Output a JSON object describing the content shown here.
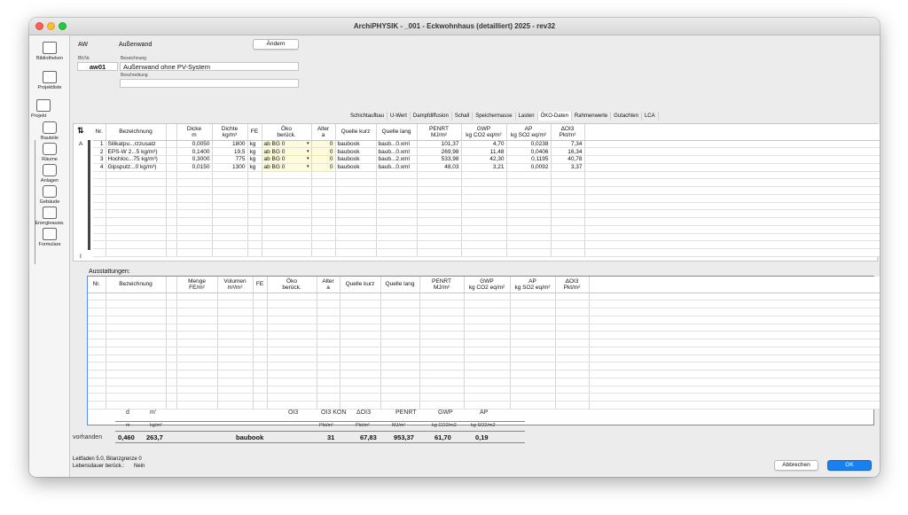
{
  "window": {
    "title": "ArchiPHYSIK - _001 - Eckwohnhaus (detailliert) 2025 - rev32"
  },
  "sidebar": {
    "items": [
      {
        "label": "Bibliotheken"
      },
      {
        "label": "Projektliste"
      },
      {
        "label": "Projekt"
      },
      {
        "label": "Bauteile"
      },
      {
        "label": "Räume"
      },
      {
        "label": "Anlagen"
      },
      {
        "label": "Gebäude"
      },
      {
        "label": "Energieausw."
      },
      {
        "label": "Formulare"
      }
    ]
  },
  "header": {
    "type_code": "AW",
    "type_name": "Außenwand",
    "change_button": "Ändern",
    "blt_nr_label": "Blt.Nr.",
    "blt_nr_value": "aw01",
    "bezeichnung_label": "Bezeichnung",
    "bezeichnung_value": "Außenwand ohne PV-System",
    "beschreibung_label": "Beschreibung",
    "beschreibung_value": ""
  },
  "tabs": [
    "Schichtaufbau",
    "U-Wert",
    "Dampfdiffusion",
    "Schall",
    "Speichermasse",
    "Lasten",
    "ÖKO-Daten",
    "Rahmenwerte",
    "Gutachten",
    "LCA"
  ],
  "active_tab": "ÖKO-Daten",
  "layers": {
    "side_marker_top": "A",
    "side_marker_bottom": "I",
    "sort_icon": "⇅",
    "columns": [
      "Nr.",
      "Bezeichnung",
      "",
      "Dicke\nm",
      "Dichte\nkg/m³",
      "FE",
      "Öko\nberück.",
      "Alter\na",
      "Quelle kurz",
      "Quelle lang",
      "PENRT\nMJ/m²",
      "GWP\nkg CO2 eq/m²",
      "AP\nkg SO2 eq/m²",
      "ΔOI3\nPkt/m²",
      ""
    ],
    "rows": [
      [
        "1",
        "Silikatpu...rzzusatz",
        "",
        "0,0050",
        "1800",
        "kg",
        "ab BG 0",
        "0",
        "baubook",
        "baub...0.xml",
        "101,37",
        "4,70",
        "0,0238",
        "7,34"
      ],
      [
        "2",
        "EPS-W 2...5 kg/m³)",
        "",
        "0,1400",
        "19,5",
        "kg",
        "ab BG 0",
        "0",
        "baubook",
        "baub...0.xml",
        "269,98",
        "11,48",
        "0,0406",
        "16,34"
      ],
      [
        "3",
        "Hochloc...75 kg/m³)",
        "",
        "0,3000",
        "775",
        "kg",
        "ab BG 0",
        "0",
        "baubook",
        "baub...2.xml",
        "533,98",
        "42,30",
        "0,1195",
        "40,78"
      ],
      [
        "4",
        "Gipsputz...0 kg/m³)",
        "",
        "0,0150",
        "1300",
        "kg",
        "ab BG 0",
        "0",
        "baubook",
        "baub...0.xml",
        "48,03",
        "3,21",
        "0,0092",
        "3,37"
      ]
    ]
  },
  "fittings": {
    "label": "Ausstattungen:",
    "columns": [
      "Nr.",
      "Bezeichnung",
      "",
      "Menge\nFE/m²",
      "Volumen\nm³/m²",
      "FE",
      "Öko\nberück.",
      "Alter\na",
      "Quelle kurz",
      "Quelle lang",
      "PENRT\nMJ/m²",
      "GWP\nkg CO2 eq/m²",
      "AP\nkg SO2 eq/m²",
      "ΔOI3\nPkt/m²",
      ""
    ]
  },
  "summary": {
    "headers": [
      "d",
      "m'",
      "OI3",
      "OI3 KON",
      "ΔOI3",
      "PENRT",
      "GWP",
      "AP"
    ],
    "units": [
      "m",
      "kg/m²",
      "Pkt/m²",
      "Pkt/m²",
      "MJ/m²",
      "kg CO2/m2",
      "kg SO2/m2"
    ],
    "row_label": "vorhanden",
    "values": [
      "0,460",
      "263,7",
      "baubook",
      "31",
      "67,83",
      "953,37",
      "61,70",
      "0,19"
    ]
  },
  "footer": {
    "line1": "Leitfaden 5.0, Bilanzgrenze 0",
    "line2_label": "Lebensdauer berück.:",
    "line2_value": "Nein",
    "cancel": "Abbrechen",
    "ok": "OK"
  },
  "colors": {
    "accent": "#1a7ff0",
    "highlight": "#fefbd8",
    "focus_border": "#5b8def"
  }
}
